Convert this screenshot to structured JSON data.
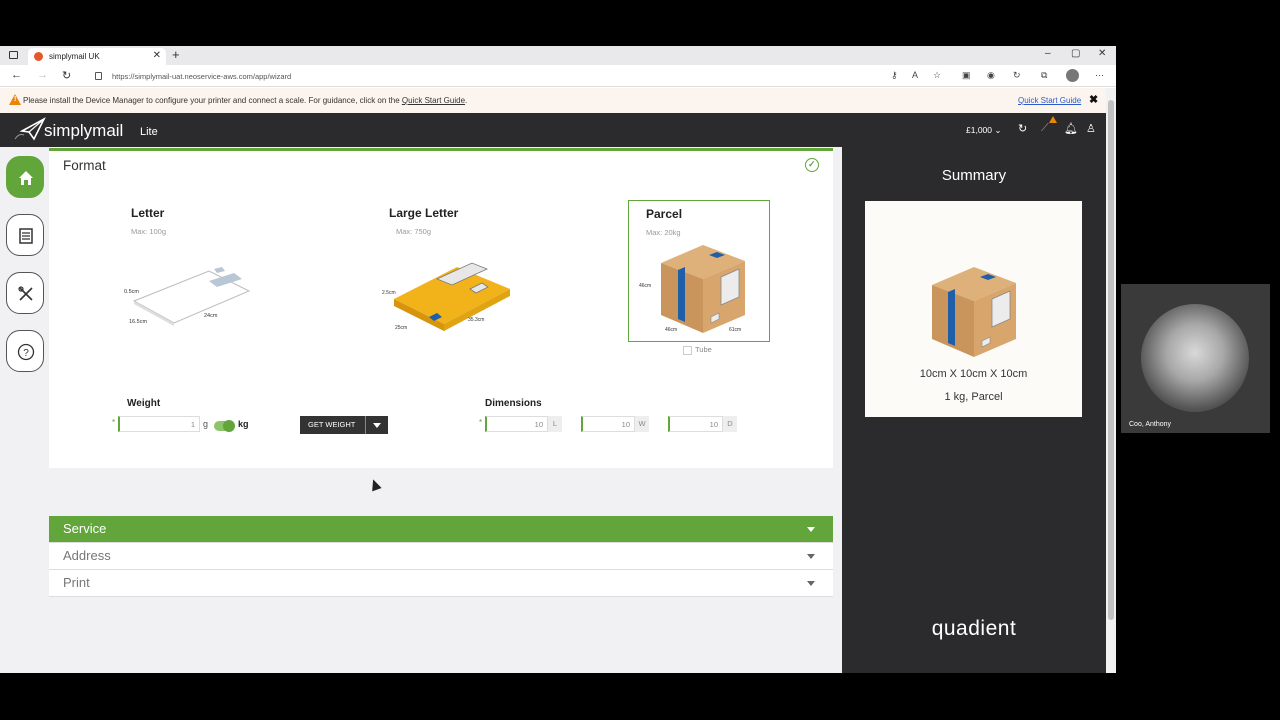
{
  "browser": {
    "tab_title": "simplymail UK",
    "tab_close": "✕",
    "new_tab": "+",
    "url": "https://simplymail-uat.neoservice-aws.com/app/wizard",
    "win_min": "–",
    "win_max": "▢",
    "win_close": "✕"
  },
  "banner": {
    "message": "Please install the Device Manager to configure your printer and connect a scale. For guidance, click on the",
    "link": "Quick Start Guide",
    "period": ".",
    "right_link": "Quick Start Guide",
    "close": "✖"
  },
  "appbar": {
    "logo_word": "simplymail",
    "logo_suffix": "Lite",
    "balance": "£1,000"
  },
  "format": {
    "title": "Format",
    "options": [
      {
        "name": "Letter",
        "max": "Max: 100g",
        "dims": [
          "0.5cm",
          "24cm",
          "16.5cm"
        ]
      },
      {
        "name": "Large Letter",
        "max": "Max: 750g",
        "dims": [
          "2.5cm",
          "35.3cm",
          "25cm"
        ]
      },
      {
        "name": "Parcel",
        "max": "Max: 20kg",
        "dims": [
          "46cm",
          "46cm",
          "61cm"
        ]
      }
    ],
    "selected": "Parcel",
    "tube_label": "Tube",
    "weight_label": "Weight",
    "weight_value": "1",
    "weight_unit_g": "g",
    "weight_unit_kg": "kg",
    "get_weight": "GET WEIGHT",
    "dimensions_label": "Dimensions",
    "dim_l": "10",
    "dim_w": "10",
    "dim_d": "10",
    "unit_l": "L",
    "unit_w": "W",
    "unit_d": "D",
    "required_mark": "*"
  },
  "sections": {
    "service": "Service",
    "address": "Address",
    "print": "Print"
  },
  "summary": {
    "title": "Summary",
    "dimensions": "10cm X 10cm X 10cm",
    "weight_format": "1 kg, Parcel",
    "brand": "quadient"
  },
  "webcam": {
    "name": "Coo, Anthony"
  },
  "colors": {
    "accent": "#61a53b",
    "dark": "#2b2b2d",
    "warning": "#e8860a",
    "parcel_tan": "#c9955c",
    "tape_blue": "#1f5fa8",
    "large_letter_yellow": "#f2b21a"
  }
}
